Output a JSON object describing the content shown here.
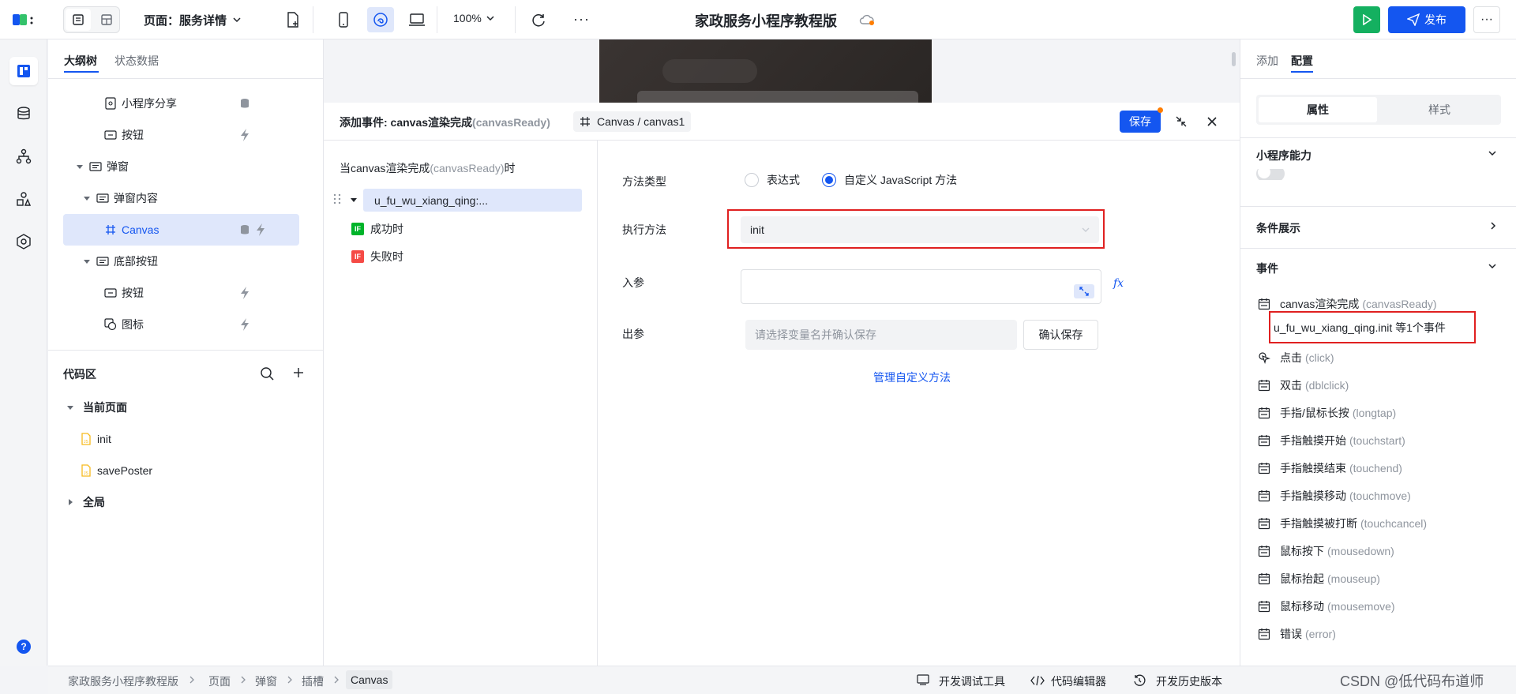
{
  "topbar": {
    "page_label": "页面：服务详情",
    "zoom": "100%",
    "app_title": "家政服务小程序教程版",
    "publish_label": "发布"
  },
  "left": {
    "tabs": [
      "大纲树",
      "状态数据"
    ],
    "tree": [
      {
        "label": "小程序分享",
        "icon": "share-page-icon",
        "badge": "database-icon"
      },
      {
        "label": "按钮",
        "icon": "button-icon",
        "badge": "lightning-icon"
      },
      {
        "label": "弹窗",
        "icon": "container-icon",
        "expand": true
      },
      {
        "label": "弹窗内容",
        "icon": "container-icon",
        "expand": true
      },
      {
        "label": "Canvas",
        "icon": "canvas-icon",
        "selected": true
      },
      {
        "label": "底部按钮",
        "icon": "container-icon",
        "expand": true
      },
      {
        "label": "按钮",
        "icon": "button-icon",
        "badge": "lightning-icon"
      },
      {
        "label": "图标",
        "icon": "icon-component-icon",
        "badge": "lightning-icon"
      }
    ],
    "code_section": {
      "title": "代码区",
      "current_page": "当前页面",
      "files": [
        "init",
        "savePoster"
      ],
      "global": "全局"
    }
  },
  "dialog": {
    "title_prefix": "添加事件: canvas渲染完成",
    "title_event": "(canvasReady)",
    "component_path": "Canvas / canvas1",
    "save_label": "保存",
    "trigger_prefix": "当canvas渲染完成",
    "trigger_event": "(canvasReady)",
    "trigger_suffix": "时",
    "action_node": "u_fu_wu_xiang_qing:...",
    "success_label": "成功时",
    "failure_label": "失败时",
    "if_badge": "IF",
    "method_type_label": "方法类型",
    "method_option_expression": "表达式",
    "method_option_custom": "自定义 JavaScript 方法",
    "exec_method_label": "执行方法",
    "exec_method_value": "init",
    "input_param_label": "入参",
    "fx_label": "fx",
    "output_param_label": "出参",
    "output_placeholder": "请选择变量名并确认保存",
    "confirm_save_label": "确认保存",
    "manage_methods_link": "管理自定义方法"
  },
  "right": {
    "tabs": [
      "添加",
      "配置"
    ],
    "segments": [
      "属性",
      "样式"
    ],
    "sections": {
      "miniapp": "小程序能力",
      "condition": "条件展示",
      "events": "事件"
    },
    "events": [
      {
        "cn": "canvas渲染完成",
        "en": "(canvasReady)"
      },
      {
        "cn": "点击",
        "en": "(click)"
      },
      {
        "cn": "双击",
        "en": "(dblclick)"
      },
      {
        "cn": "手指/鼠标长按",
        "en": "(longtap)"
      },
      {
        "cn": "手指触摸开始",
        "en": "(touchstart)"
      },
      {
        "cn": "手指触摸结束",
        "en": "(touchend)"
      },
      {
        "cn": "手指触摸移动",
        "en": "(touchmove)"
      },
      {
        "cn": "手指触摸被打断",
        "en": "(touchcancel)"
      },
      {
        "cn": "鼠标按下",
        "en": "(mousedown)"
      },
      {
        "cn": "鼠标抬起",
        "en": "(mouseup)"
      },
      {
        "cn": "鼠标移动",
        "en": "(mousemove)"
      },
      {
        "cn": "错误",
        "en": "(error)"
      }
    ],
    "bound_event": "u_fu_wu_xiang_qing.init 等1个事件"
  },
  "bottom": {
    "breadcrumbs": [
      "家政服务小程序教程版",
      "页面",
      "弹窗",
      "插槽",
      "Canvas"
    ],
    "tools": [
      "开发调试工具",
      "代码编辑器",
      "开发历史版本"
    ],
    "watermark": "CSDN @低代码布道师"
  },
  "colors": {
    "primary": "#1456f0",
    "selected_bg": "#dfe7fb",
    "highlight_box": "#e02020",
    "success_green": "#00b42a",
    "play_green": "#14b060"
  }
}
